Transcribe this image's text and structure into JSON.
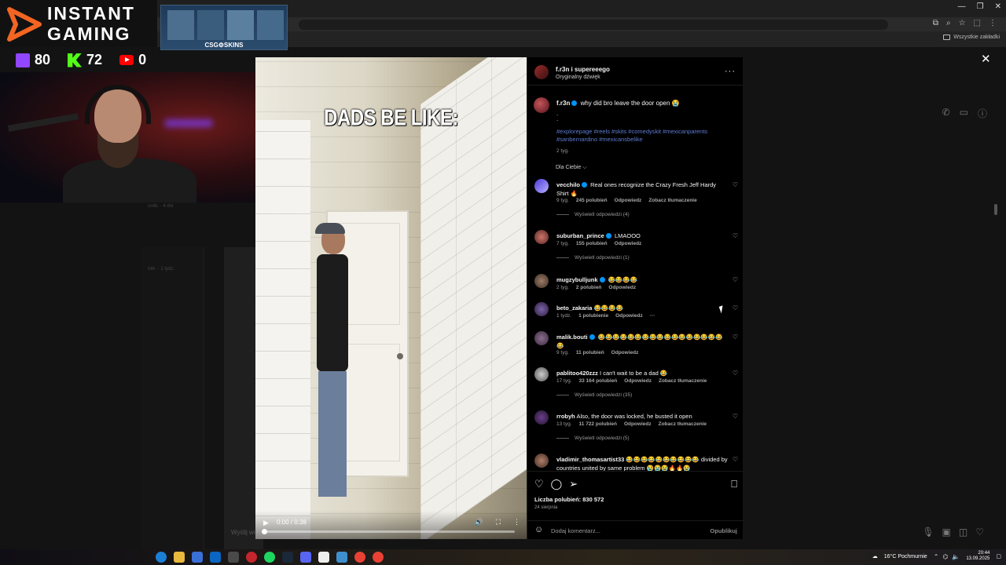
{
  "overlay": {
    "brand_line1": "INSTANT",
    "brand_line2": "GAMING",
    "sponsor": "CSG",
    "sponsor_suffix": "SKINS",
    "counters": [
      {
        "platform": "twitch",
        "value": "80"
      },
      {
        "platform": "kick",
        "value": "72"
      },
      {
        "platform": "youtube",
        "value": "0"
      }
    ]
  },
  "browser": {
    "bookmark_folder": "Wszystkie zakładki",
    "window_controls": [
      "—",
      "❐",
      "✕"
    ]
  },
  "video": {
    "caption": "DADS BE LIKE:",
    "time": "0:00 / 0:38",
    "progress": 0
  },
  "post": {
    "header_user": "f.r3n i supereeego",
    "audio": "Oryginalny dźwięk",
    "caption": {
      "user": "f.r3n",
      "text": "why did bro leave the door open 😭",
      "dots": ".\n.",
      "tags": "#explorepage #reels #skits #comedyskit #mexicanparents #sanbernardino #mexicansbelike",
      "time": "2 tyg."
    },
    "filter_label": "Dla Ciebie ⌵",
    "comments": [
      {
        "user": "vecchilo",
        "verified": true,
        "text": "Real ones recognize the Crazy Fresh Jeff Hardy Shirt 🔥",
        "time": "9 tyg.",
        "likes": "245 polubień",
        "reply": "Odpowiedz",
        "translate": "Zobacz tłumaczenie",
        "replies": "Wyświetl odpowiedzi (4)"
      },
      {
        "user": "suburban_prince",
        "verified": true,
        "text": "LMAOOO",
        "time": "7 tyg.",
        "likes": "155 polubień",
        "reply": "Odpowiedz",
        "translate": "",
        "replies": "Wyświetl odpowiedzi (1)"
      },
      {
        "user": "mugzybulljunk",
        "verified": true,
        "text": "😂😂😂😂",
        "time": "2 tyg.",
        "likes": "2 polubień",
        "reply": "Odpowiedz",
        "translate": "",
        "replies": ""
      },
      {
        "user": "beto_zakaria",
        "verified": false,
        "text": "😂😂😂😂",
        "time": "1 tydz.",
        "likes": "1 polubienie",
        "reply": "Odpowiedz",
        "translate": "···",
        "replies": ""
      },
      {
        "user": "malik.bouti",
        "verified": true,
        "text": "😂😂😂😂😂😂😂😂😂😂😂😂😂😂😂😂😂😂",
        "time": "9 tyg.",
        "likes": "11 polubień",
        "reply": "Odpowiedz",
        "translate": "",
        "replies": ""
      },
      {
        "user": "pablitoo420zzz",
        "verified": false,
        "text": "I can't wait to be a dad 😂",
        "time": "17 tyg.",
        "likes": "33 164 polubień",
        "reply": "Odpowiedz",
        "translate": "Zobacz tłumaczenie",
        "replies": "Wyświetl odpowiedzi (35)"
      },
      {
        "user": "rrobyh",
        "verified": false,
        "text": "Also, the door was locked, he busted it open",
        "time": "13 tyg.",
        "likes": "11 722 polubień",
        "reply": "Odpowiedz",
        "translate": "Zobacz tłumaczenie",
        "replies": "Wyświetl odpowiedzi (5)"
      },
      {
        "user": "vladimir_thomasartist33",
        "verified": false,
        "text": "😂😂😂😂😂😂😂😂😂😂 divided by countries united by same problem 😭😭😭🔥🔥😭",
        "time": "",
        "likes": "",
        "reply": "",
        "translate": "",
        "replies": ""
      }
    ],
    "likes_label": "Liczba polubień: 830 572",
    "date": "24 sierpnia",
    "comment_placeholder": "Dodaj komentarz...",
    "post_button": "Opublikuj"
  },
  "background": {
    "message_placeholder": "Wyślij wi",
    "bg_user1": "cmlk. · 4 dni",
    "bg_user2": "mlk. · 1 tydz."
  },
  "taskbar": {
    "weather": "16°C Pochmurnie",
    "time": "20:44",
    "date": "13.09.2025"
  },
  "colors": {
    "accent_blue": "#0095f6",
    "hashtag": "#5f7bd2",
    "twitch": "#9146ff",
    "kick": "#53fc18",
    "youtube": "#ff0000"
  }
}
